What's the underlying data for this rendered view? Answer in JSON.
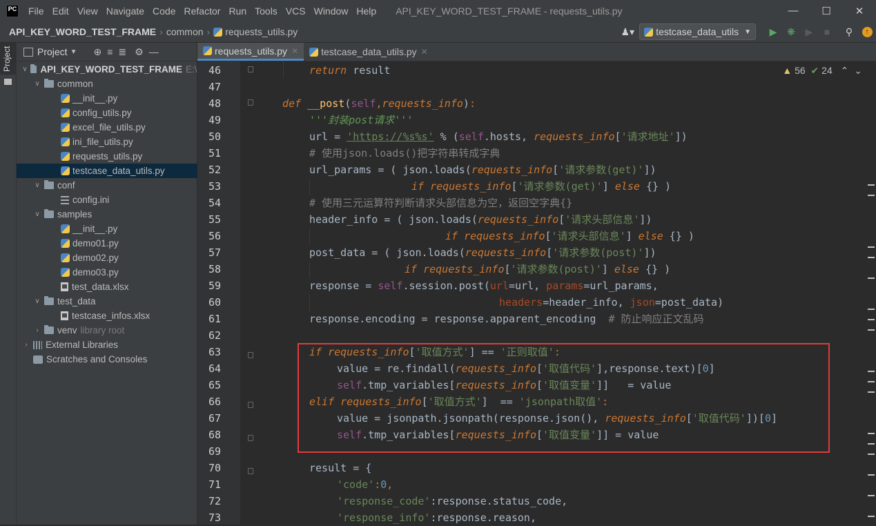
{
  "window": {
    "title": "API_KEY_WORD_TEST_FRAME - requests_utils.py",
    "menu": [
      "File",
      "Edit",
      "View",
      "Navigate",
      "Code",
      "Refactor",
      "Run",
      "Tools",
      "VCS",
      "Window",
      "Help"
    ],
    "logo": "PC"
  },
  "navbar": {
    "project": "API_KEY_WORD_TEST_FRAME",
    "folder": "common",
    "file": "requests_utils.py",
    "run_config": "testcase_data_utils"
  },
  "project_panel": {
    "title": "Project",
    "side_tab": "Project",
    "root": "API_KEY_WORD_TEST_FRAME",
    "root_path": "E:\\p",
    "items": {
      "common": "common",
      "init1": "__init__.py",
      "config_utils": "config_utils.py",
      "excel_file_utils": "excel_file_utils.py",
      "ini_file_utils": "ini_file_utils.py",
      "requests_utils": "requests_utils.py",
      "testcase_data_utils": "testcase_data_utils.py",
      "conf": "conf",
      "config_ini": "config.ini",
      "samples": "samples",
      "init2": "__init__.py",
      "demo01": "demo01.py",
      "demo02": "demo02.py",
      "demo03": "demo03.py",
      "test_data_xlsx": "test_data.xlsx",
      "test_data": "test_data",
      "testcase_infos": "testcase_infos.xlsx",
      "venv": "venv",
      "venv_note": "library root",
      "external": "External Libraries",
      "scratches": "Scratches and Consoles"
    }
  },
  "editor": {
    "tabs": [
      "requests_utils.py",
      "testcase_data_utils.py"
    ],
    "warnings": "56",
    "weak": "24",
    "line_numbers": [
      "46",
      "47",
      "48",
      "49",
      "50",
      "51",
      "52",
      "53",
      "54",
      "55",
      "56",
      "57",
      "58",
      "59",
      "60",
      "61",
      "62",
      "63",
      "64",
      "65",
      "66",
      "67",
      "68",
      "69",
      "70",
      "71",
      "72",
      "73"
    ]
  },
  "code": {
    "l46_return": "return",
    "l46_result": " result",
    "l48_def": "def",
    "l48_name": "__post",
    "l48_self": "self",
    "l48_param": "requests_info",
    "l49": "'''封装post请求'''",
    "l50_a": "url = ",
    "l50_str": "'https://%s%s'",
    "l50_b": " % (",
    "l50_self": "self",
    "l50_c": ".hosts, ",
    "l50_p": "requests_info",
    "l50_key": "'请求地址'",
    "l50_d": "])",
    "l51": "# 使用json.loads()把字符串转成字典",
    "l52_a": "url_params = ( json.",
    "l52_fn": "loads",
    "l52_p": "requests_info",
    "l52_key": "'请求参数(get)'",
    "l52_b": "])",
    "l53_if": "if",
    "l53_p": "requests_info",
    "l53_key": "'请求参数(get)'",
    "l53_else": "else",
    "l53_b": " {} )",
    "l54": "# 使用三元运算符判断请求头部信息为空，返回空字典{}",
    "l55_a": "header_info = ( json.",
    "l55_fn": "loads",
    "l55_p": "requests_info",
    "l55_key": "'请求头部信息'",
    "l55_b": "])",
    "l56_if": "if",
    "l56_p": "requests_info",
    "l56_key": "'请求头部信息'",
    "l56_else": "else",
    "l56_b": " {} )",
    "l57_a": "post_data = ( json.",
    "l57_fn": "loads",
    "l57_p": "requests_info",
    "l57_key": "'请求参数(post)'",
    "l57_b": "])",
    "l58_if": "if",
    "l58_p": "requests_info",
    "l58_key": "'请求参数(post)'",
    "l58_else": "else",
    "l58_b": " {} )",
    "l59_a": "response = ",
    "l59_self": "self",
    "l59_b": ".session.",
    "l59_fn": "post",
    "l59_k1": "url",
    "l59_c": "=url, ",
    "l59_k2": "params",
    "l59_d": "=url_params,",
    "l60_k1": "headers",
    "l60_a": "=header_info, ",
    "l60_k2": "json",
    "l60_b": "=post_data)",
    "l61_a": "response.encoding = response.apparent_encoding  ",
    "l61_cm": "# 防止响应正文乱码",
    "l63_if": "if",
    "l63_p": "requests_info",
    "l63_key": "'取值方式'",
    "l63_a": "] == ",
    "l63_val": "'正则取值'",
    "l64_a": "value = re.",
    "l64_fn": "findall",
    "l64_p": "requests_info",
    "l64_key": "'取值代码'",
    "l64_b": "],response.text)[",
    "l64_n": "0",
    "l65_self": "self",
    "l65_a": ".tmp_variables[",
    "l65_p": "requests_info",
    "l65_key": "'取值变量'",
    "l65_b": "]]   = value",
    "l66_elif": "elif",
    "l66_p": "requests_info",
    "l66_key": "'取值方式'",
    "l66_a": "]  == ",
    "l66_val": "'jsonpath取值'",
    "l67_a": "value = jsonpath.",
    "l67_fn": "jsonpath",
    "l67_b": "(response.",
    "l67_fn2": "json",
    "l67_c": "(), ",
    "l67_p": "requests_info",
    "l67_key": "'取值代码'",
    "l67_d": "])[",
    "l67_n": "0",
    "l68_self": "self",
    "l68_a": ".tmp_variables[",
    "l68_p": "requests_info",
    "l68_key": "'取值变量'",
    "l68_b": "]] = value",
    "l70": "result = {",
    "l71_key": "'code'",
    "l71_n": "0",
    "l72_key": "'response_code'",
    "l72_a": ":response.status_code,",
    "l73_key": "'response_info'",
    "l73_a": ":response.reason,"
  }
}
